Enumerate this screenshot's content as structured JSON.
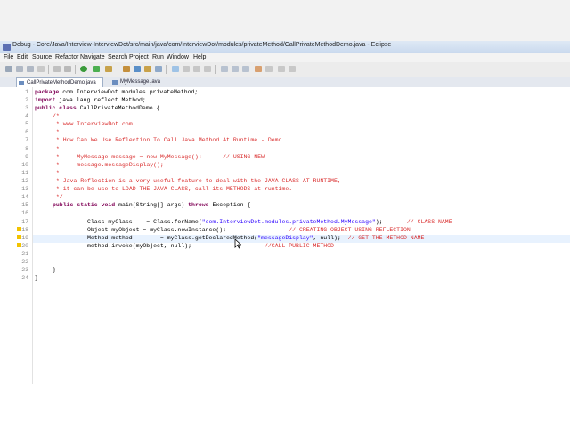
{
  "window": {
    "title": "Debug - Core/Java/Interview-InterviewDot/src/main/java/com/InterviewDot/modules/privateMethod/CallPrivateMethodDemo.java - Eclipse"
  },
  "menu": [
    "File",
    "Edit",
    "Source",
    "Refactor",
    "Navigate",
    "Search",
    "Project",
    "Run",
    "Window",
    "Help"
  ],
  "tabs": [
    {
      "label": "CallPrivateMethodDemo.java",
      "active": true
    },
    {
      "label": "MyMessage.java",
      "active": false
    }
  ],
  "line_numbers": [
    "1",
    "2",
    "3",
    "4",
    "5",
    "6",
    "7",
    "8",
    "9",
    "10",
    "11",
    "12",
    "13",
    "14",
    "15",
    "16",
    "17",
    "18",
    "19",
    "20",
    "21",
    "22",
    "23",
    "24"
  ],
  "code": {
    "l1_kw": "package",
    "l1_rest": " com.InterviewDot.modules.privateMethod;",
    "l2_kw": "import",
    "l2_rest": " java.lang.reflect.Method;",
    "l3_kw": "public class",
    "l3_rest": " CallPrivateMethodDemo {",
    "l4": "/*",
    "l5": " * www.InterviewDot.com",
    "l6": " *",
    "l7": " * How Can We Use Reflection To Call Java Method At Runtime - Demo",
    "l8": " *",
    "l9": " *     MyMessage message = new MyMessage();      // USING NEW",
    "l10": " *     message.messageDisplay();",
    "l11": " *",
    "l12": " * Java Reflection is a very useful feature to deal with the JAVA CLASS AT RUNTIME,",
    "l13": " * it can be use to LOAD THE JAVA CLASS, call its METHODS at runtime.",
    "l14": " */",
    "l15_kw": "public static void",
    "l15_rest": " main(String[] args) ",
    "l15_kw2": "throws",
    "l15_rest2": " Exception {",
    "l17_a": "Class myClass    = Class.forName(",
    "l17_str": "\"com.InterviewDot.modules.privateMethod.MyMessage\"",
    "l17_b": ");       ",
    "l17_cm": "// CLASS NAME",
    "l18_a": "Object myObject = myClass.newInstance();                  ",
    "l18_cm": "// CREATING OBJECT USING REFLECTION",
    "l19_a": "Method method        = myClass.getDeclaredMethod(",
    "l19_str": "\"messageDisplay\"",
    "l19_b": ", null);  ",
    "l19_cm": "// GET THE METHOD NAME",
    "l20_a": "method.invoke(myObject, null);                     ",
    "l20_cm": "//CALL PUBLIC METHOD",
    "l22": "}",
    "l23": "}"
  },
  "colors": {
    "keyword": "#7f0055",
    "comment": "#d92c2c",
    "string": "#2a00ff"
  }
}
